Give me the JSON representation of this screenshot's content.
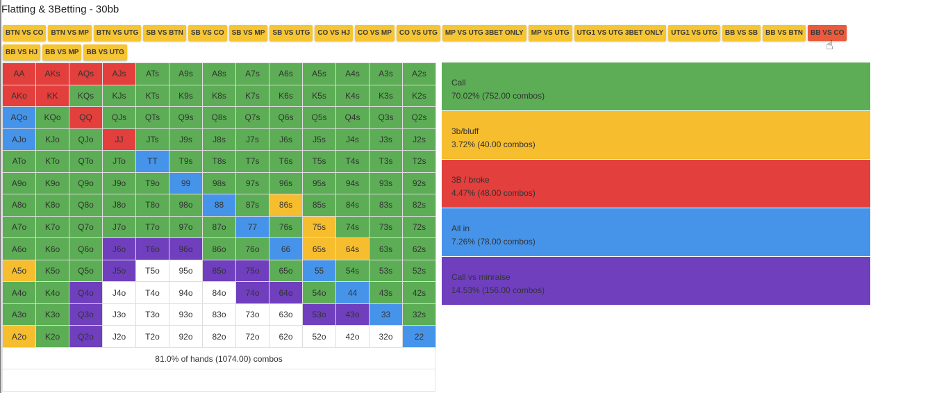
{
  "title": "Flatting & 3Betting - 30bb",
  "colors": {
    "call": "#5cad55",
    "bluff": "#f6bd2e",
    "broke": "#e23f3d",
    "allin": "#4694ea",
    "minraise": "#6f3fbe",
    "none": "#ffffff",
    "tab": "#f6c533",
    "tab_active": "#ea5a3c"
  },
  "tabs": [
    {
      "label": "BTN VS CO",
      "active": false
    },
    {
      "label": "BTN VS MP",
      "active": false
    },
    {
      "label": "BTN VS UTG",
      "active": false
    },
    {
      "label": "SB VS BTN",
      "active": false
    },
    {
      "label": "SB VS CO",
      "active": false
    },
    {
      "label": "SB VS MP",
      "active": false
    },
    {
      "label": "SB VS UTG",
      "active": false
    },
    {
      "label": "CO VS HJ",
      "active": false
    },
    {
      "label": "CO VS MP",
      "active": false
    },
    {
      "label": "CO VS UTG",
      "active": false
    },
    {
      "label": "MP VS UTG 3BET ONLY",
      "active": false
    },
    {
      "label": "MP VS UTG",
      "active": false
    },
    {
      "label": "UTG1 VS UTG 3BET ONLY",
      "active": false
    },
    {
      "label": "UTG1 VS UTG",
      "active": false
    },
    {
      "label": "BB VS SB",
      "active": false
    },
    {
      "label": "BB VS BTN",
      "active": false
    },
    {
      "label": "BB VS CO",
      "active": true
    },
    {
      "label": "BB VS HJ",
      "active": false
    },
    {
      "label": "BB VS MP",
      "active": false
    },
    {
      "label": "BB VS UTG",
      "active": false
    }
  ],
  "grid": [
    [
      [
        "AA",
        "broke"
      ],
      [
        "AKs",
        "broke"
      ],
      [
        "AQs",
        "broke"
      ],
      [
        "AJs",
        "broke"
      ],
      [
        "ATs",
        "call"
      ],
      [
        "A9s",
        "call"
      ],
      [
        "A8s",
        "call"
      ],
      [
        "A7s",
        "call"
      ],
      [
        "A6s",
        "call"
      ],
      [
        "A5s",
        "call"
      ],
      [
        "A4s",
        "call"
      ],
      [
        "A3s",
        "call"
      ],
      [
        "A2s",
        "call"
      ]
    ],
    [
      [
        "AKo",
        "broke"
      ],
      [
        "KK",
        "broke"
      ],
      [
        "KQs",
        "call"
      ],
      [
        "KJs",
        "call"
      ],
      [
        "KTs",
        "call"
      ],
      [
        "K9s",
        "call"
      ],
      [
        "K8s",
        "call"
      ],
      [
        "K7s",
        "call"
      ],
      [
        "K6s",
        "call"
      ],
      [
        "K5s",
        "call"
      ],
      [
        "K4s",
        "call"
      ],
      [
        "K3s",
        "call"
      ],
      [
        "K2s",
        "call"
      ]
    ],
    [
      [
        "AQo",
        "allin"
      ],
      [
        "KQo",
        "call"
      ],
      [
        "QQ",
        "broke"
      ],
      [
        "QJs",
        "call"
      ],
      [
        "QTs",
        "call"
      ],
      [
        "Q9s",
        "call"
      ],
      [
        "Q8s",
        "call"
      ],
      [
        "Q7s",
        "call"
      ],
      [
        "Q6s",
        "call"
      ],
      [
        "Q5s",
        "call"
      ],
      [
        "Q4s",
        "call"
      ],
      [
        "Q3s",
        "call"
      ],
      [
        "Q2s",
        "call"
      ]
    ],
    [
      [
        "AJo",
        "allin"
      ],
      [
        "KJo",
        "call"
      ],
      [
        "QJo",
        "call"
      ],
      [
        "JJ",
        "broke"
      ],
      [
        "JTs",
        "call"
      ],
      [
        "J9s",
        "call"
      ],
      [
        "J8s",
        "call"
      ],
      [
        "J7s",
        "call"
      ],
      [
        "J6s",
        "call"
      ],
      [
        "J5s",
        "call"
      ],
      [
        "J4s",
        "call"
      ],
      [
        "J3s",
        "call"
      ],
      [
        "J2s",
        "call"
      ]
    ],
    [
      [
        "ATo",
        "call"
      ],
      [
        "KTo",
        "call"
      ],
      [
        "QTo",
        "call"
      ],
      [
        "JTo",
        "call"
      ],
      [
        "TT",
        "allin"
      ],
      [
        "T9s",
        "call"
      ],
      [
        "T8s",
        "call"
      ],
      [
        "T7s",
        "call"
      ],
      [
        "T6s",
        "call"
      ],
      [
        "T5s",
        "call"
      ],
      [
        "T4s",
        "call"
      ],
      [
        "T3s",
        "call"
      ],
      [
        "T2s",
        "call"
      ]
    ],
    [
      [
        "A9o",
        "call"
      ],
      [
        "K9o",
        "call"
      ],
      [
        "Q9o",
        "call"
      ],
      [
        "J9o",
        "call"
      ],
      [
        "T9o",
        "call"
      ],
      [
        "99",
        "allin"
      ],
      [
        "98s",
        "call"
      ],
      [
        "97s",
        "call"
      ],
      [
        "96s",
        "call"
      ],
      [
        "95s",
        "call"
      ],
      [
        "94s",
        "call"
      ],
      [
        "93s",
        "call"
      ],
      [
        "92s",
        "call"
      ]
    ],
    [
      [
        "A8o",
        "call"
      ],
      [
        "K8o",
        "call"
      ],
      [
        "Q8o",
        "call"
      ],
      [
        "J8o",
        "call"
      ],
      [
        "T8o",
        "call"
      ],
      [
        "98o",
        "call"
      ],
      [
        "88",
        "allin"
      ],
      [
        "87s",
        "call"
      ],
      [
        "86s",
        "bluff"
      ],
      [
        "85s",
        "call"
      ],
      [
        "84s",
        "call"
      ],
      [
        "83s",
        "call"
      ],
      [
        "82s",
        "call"
      ]
    ],
    [
      [
        "A7o",
        "call"
      ],
      [
        "K7o",
        "call"
      ],
      [
        "Q7o",
        "call"
      ],
      [
        "J7o",
        "call"
      ],
      [
        "T7o",
        "call"
      ],
      [
        "97o",
        "call"
      ],
      [
        "87o",
        "call"
      ],
      [
        "77",
        "allin"
      ],
      [
        "76s",
        "call"
      ],
      [
        "75s",
        "bluff"
      ],
      [
        "74s",
        "call"
      ],
      [
        "73s",
        "call"
      ],
      [
        "72s",
        "call"
      ]
    ],
    [
      [
        "A6o",
        "call"
      ],
      [
        "K6o",
        "call"
      ],
      [
        "Q6o",
        "call"
      ],
      [
        "J6o",
        "minraise"
      ],
      [
        "T6o",
        "minraise"
      ],
      [
        "96o",
        "minraise"
      ],
      [
        "86o",
        "call"
      ],
      [
        "76o",
        "call"
      ],
      [
        "66",
        "allin"
      ],
      [
        "65s",
        "bluff"
      ],
      [
        "64s",
        "bluff"
      ],
      [
        "63s",
        "call"
      ],
      [
        "62s",
        "call"
      ]
    ],
    [
      [
        "A5o",
        "bluff"
      ],
      [
        "K5o",
        "call"
      ],
      [
        "Q5o",
        "call"
      ],
      [
        "J5o",
        "minraise"
      ],
      [
        "T5o",
        "none"
      ],
      [
        "95o",
        "none"
      ],
      [
        "85o",
        "minraise"
      ],
      [
        "75o",
        "minraise"
      ],
      [
        "65o",
        "call"
      ],
      [
        "55",
        "allin"
      ],
      [
        "54s",
        "call"
      ],
      [
        "53s",
        "call"
      ],
      [
        "52s",
        "call"
      ]
    ],
    [
      [
        "A4o",
        "call"
      ],
      [
        "K4o",
        "call"
      ],
      [
        "Q4o",
        "minraise"
      ],
      [
        "J4o",
        "none"
      ],
      [
        "T4o",
        "none"
      ],
      [
        "94o",
        "none"
      ],
      [
        "84o",
        "none"
      ],
      [
        "74o",
        "minraise"
      ],
      [
        "64o",
        "minraise"
      ],
      [
        "54o",
        "call"
      ],
      [
        "44",
        "allin"
      ],
      [
        "43s",
        "call"
      ],
      [
        "42s",
        "call"
      ]
    ],
    [
      [
        "A3o",
        "call"
      ],
      [
        "K3o",
        "call"
      ],
      [
        "Q3o",
        "minraise"
      ],
      [
        "J3o",
        "none"
      ],
      [
        "T3o",
        "none"
      ],
      [
        "93o",
        "none"
      ],
      [
        "83o",
        "none"
      ],
      [
        "73o",
        "none"
      ],
      [
        "63o",
        "none"
      ],
      [
        "53o",
        "minraise"
      ],
      [
        "43o",
        "minraise"
      ],
      [
        "33",
        "allin"
      ],
      [
        "32s",
        "call"
      ]
    ],
    [
      [
        "A2o",
        "bluff"
      ],
      [
        "K2o",
        "call"
      ],
      [
        "Q2o",
        "minraise"
      ],
      [
        "J2o",
        "none"
      ],
      [
        "T2o",
        "none"
      ],
      [
        "92o",
        "none"
      ],
      [
        "82o",
        "none"
      ],
      [
        "72o",
        "none"
      ],
      [
        "62o",
        "none"
      ],
      [
        "52o",
        "none"
      ],
      [
        "42o",
        "none"
      ],
      [
        "32o",
        "none"
      ],
      [
        "22",
        "allin"
      ]
    ]
  ],
  "summary": "81.0% of hands (1074.00) combos",
  "legend": [
    {
      "key": "call",
      "name": "Call",
      "stats": "70.02% (752.00 combos)"
    },
    {
      "key": "bluff",
      "name": "3b/bluff",
      "stats": "3.72% (40.00 combos)"
    },
    {
      "key": "broke",
      "name": "3B / broke",
      "stats": "4.47% (48.00 combos)"
    },
    {
      "key": "allin",
      "name": "All in",
      "stats": "7.26% (78.00 combos)"
    },
    {
      "key": "minraise",
      "name": "Call vs minraise",
      "stats": "14.53% (156.00 combos)"
    }
  ]
}
